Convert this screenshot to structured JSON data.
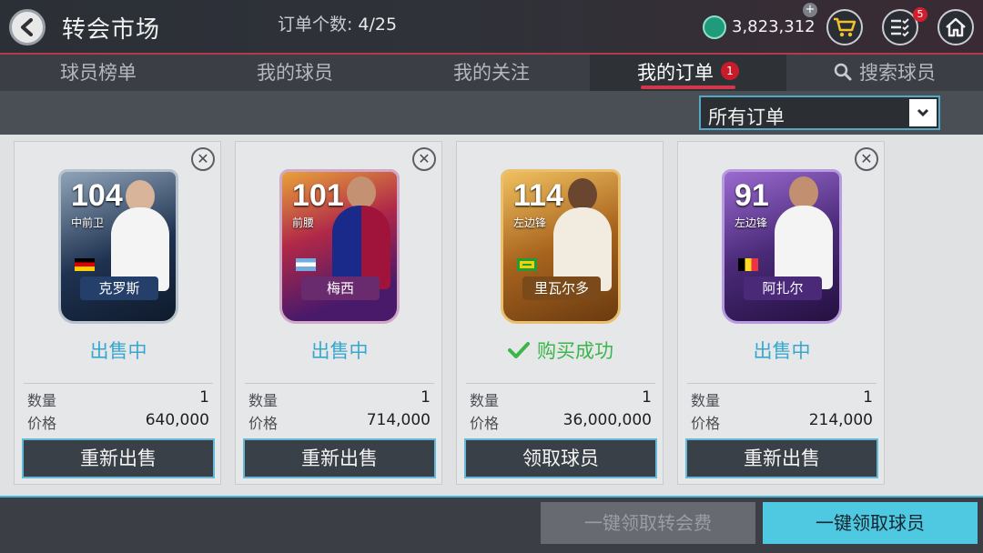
{
  "header": {
    "title": "转会市场",
    "coins": "3,823,312",
    "notification_count": "5",
    "icons": [
      "back-arrow-icon",
      "coin-icon",
      "plus-icon",
      "cart-icon",
      "checklist-icon",
      "home-icon"
    ]
  },
  "tabs": [
    {
      "label": "球员榜单"
    },
    {
      "label": "我的球员"
    },
    {
      "label": "我的关注"
    },
    {
      "label": "我的订单",
      "badge": "1",
      "active": true
    },
    {
      "label": "搜索球员"
    }
  ],
  "filter": {
    "count_label": "订单个数:",
    "count_value": "4/25",
    "dropdown_value": "所有订单"
  },
  "labels": {
    "quantity": "数量",
    "price": "价格"
  },
  "cards": [
    {
      "rating": "104",
      "position": "中前卫",
      "name": "克罗斯",
      "status": "出售中",
      "quantity": "1",
      "price": "640,000",
      "button": "重新出售",
      "theme": "#1e3250"
    },
    {
      "rating": "101",
      "position": "前腰",
      "name": "梅西",
      "status": "出售中",
      "quantity": "1",
      "price": "714,000",
      "button": "重新出售",
      "theme": "#6a1f5a"
    },
    {
      "rating": "114",
      "position": "左边锋",
      "name": "里瓦尔多",
      "status": "购买成功",
      "quantity": "1",
      "price": "36,000,000",
      "button": "领取球员",
      "theme": "#a8641e"
    },
    {
      "rating": "91",
      "position": "左边锋",
      "name": "阿扎尔",
      "status": "出售中",
      "quantity": "1",
      "price": "214,000",
      "button": "重新出售",
      "theme": "#4a2a78"
    }
  ],
  "footer": {
    "claim_fees_label": "一键领取转会费",
    "claim_players_label": "一键领取球员"
  },
  "colors": {
    "accent": "#4fc9e2",
    "selling": "#38a7d0",
    "success": "#3cb54a",
    "tab_underline": "#d4364a"
  }
}
